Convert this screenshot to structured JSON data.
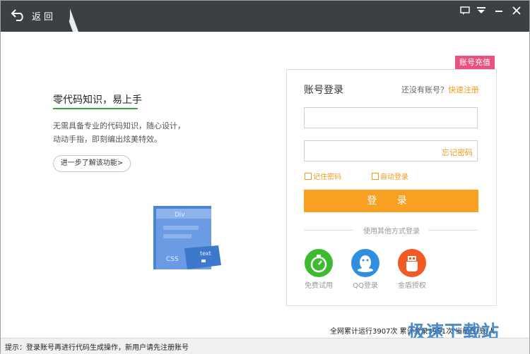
{
  "header": {
    "back_label": "返回",
    "buttons": [
      "feedback-icon",
      "menu-icon",
      "minimize-icon",
      "close-icon"
    ]
  },
  "intro": {
    "title": "零代码知识，易上手",
    "desc_line1": "无需具备专业的代码知识，随心设计，",
    "desc_line2": "动动手指，即刻编出炫美特效。",
    "learn_more": "进一步了解该功能>"
  },
  "illustration": {
    "div_label": "Div",
    "css_label": "CSS",
    "text_label": "text"
  },
  "login": {
    "recharge": "账号充值",
    "title": "账号登录",
    "no_account": "还没有账号？",
    "register": "快速注册",
    "username_placeholder": "",
    "password_placeholder": "",
    "forgot": "忘记密码",
    "remember": "记住密码",
    "auto_login": "自动登录",
    "submit": "登 录",
    "other_methods": "使用其他方式登录",
    "social": [
      {
        "label": "免费试用",
        "icon": "stopwatch-icon",
        "color": "#3dbb2e"
      },
      {
        "label": "QQ登录",
        "icon": "qq-icon",
        "color": "#2e8fe0"
      },
      {
        "label": "金盾授权",
        "icon": "usb-key-icon",
        "color": "#f15a24"
      }
    ]
  },
  "footer": {
    "stats": "全网累计运行3907次  累计登录3951次  当前在线8人",
    "status": "提示：登录账号再进行代码生成操作，新用户请先注册账号"
  },
  "watermark": "极速下载站",
  "colors": {
    "accent": "#f7a021",
    "titlebar": "#3c3f43",
    "green": "#3aaa35",
    "pink": "#e9527f"
  }
}
